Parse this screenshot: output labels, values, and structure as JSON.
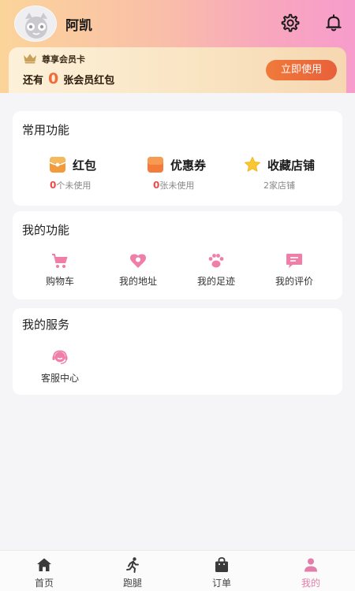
{
  "profile": {
    "username": "阿凯"
  },
  "member": {
    "title": "尊享会员卡",
    "line_prefix": "还有",
    "count": "0",
    "line_suffix": "张会员红包",
    "button": "立即使用"
  },
  "common": {
    "title": "常用功能",
    "items": [
      {
        "label": "红包",
        "num": "0",
        "sub": "个未使用",
        "icon": "red-packet-icon"
      },
      {
        "label": "优惠券",
        "num": "0",
        "sub": "张未使用",
        "icon": "coupon-icon"
      },
      {
        "label": "收藏店铺",
        "num": "",
        "sub": "2家店铺",
        "icon": "star-icon"
      }
    ]
  },
  "my_functions": {
    "title": "我的功能",
    "items": [
      {
        "label": "购物车",
        "icon": "cart-icon"
      },
      {
        "label": "我的地址",
        "icon": "address-icon"
      },
      {
        "label": "我的足迹",
        "icon": "footprint-icon"
      },
      {
        "label": "我的评价",
        "icon": "review-icon"
      }
    ]
  },
  "my_services": {
    "title": "我的服务",
    "items": [
      {
        "label": "客服中心",
        "icon": "customer-service-icon"
      }
    ]
  },
  "tabbar": {
    "items": [
      {
        "label": "首页",
        "icon": "home-icon"
      },
      {
        "label": "跑腿",
        "icon": "runner-icon"
      },
      {
        "label": "订单",
        "icon": "bag-icon"
      },
      {
        "label": "我的",
        "icon": "person-icon",
        "active": true
      }
    ]
  },
  "colors": {
    "accent_pink": "#e27ea9",
    "member_count": "#f06b3a",
    "red_number": "#ef4a4a"
  }
}
